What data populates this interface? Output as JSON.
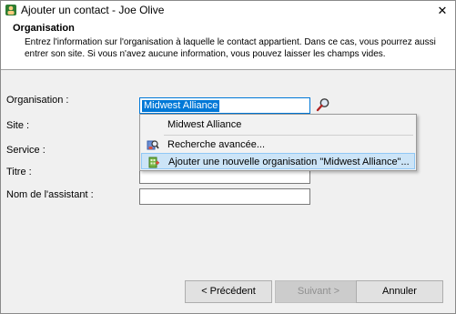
{
  "window": {
    "title": "Ajouter un contact - Joe Olive",
    "close_glyph": "✕"
  },
  "header": {
    "title": "Organisation",
    "description": "Entrez l'information sur l'organisation à laquelle le contact appartient. Dans ce cas, vous pourrez aussi entrer son site. Si vous n'avez aucune information, vous pouvez laisser les champs vides."
  },
  "form": {
    "organisation_label": "Organisation :",
    "organisation_value": "Midwest Alliance",
    "site_label": "Site :",
    "service_label": "Service :",
    "titre_label": "Titre :",
    "assistant_label": "Nom de l'assistant :"
  },
  "dropdown": {
    "items": [
      {
        "label": "Midwest Alliance",
        "icon": "none"
      },
      {
        "label": "Recherche avancée...",
        "icon": "advanced-search-icon"
      },
      {
        "label": "Ajouter une nouvelle organisation \"Midwest Alliance\"...",
        "icon": "add-organisation-icon"
      }
    ],
    "highlight_color": "#cce4f7"
  },
  "buttons": {
    "previous": "< Précédent",
    "next": "Suivant >",
    "cancel": "Annuler"
  },
  "colors": {
    "selection": "#0078d7",
    "background": "#f0f0f0"
  }
}
